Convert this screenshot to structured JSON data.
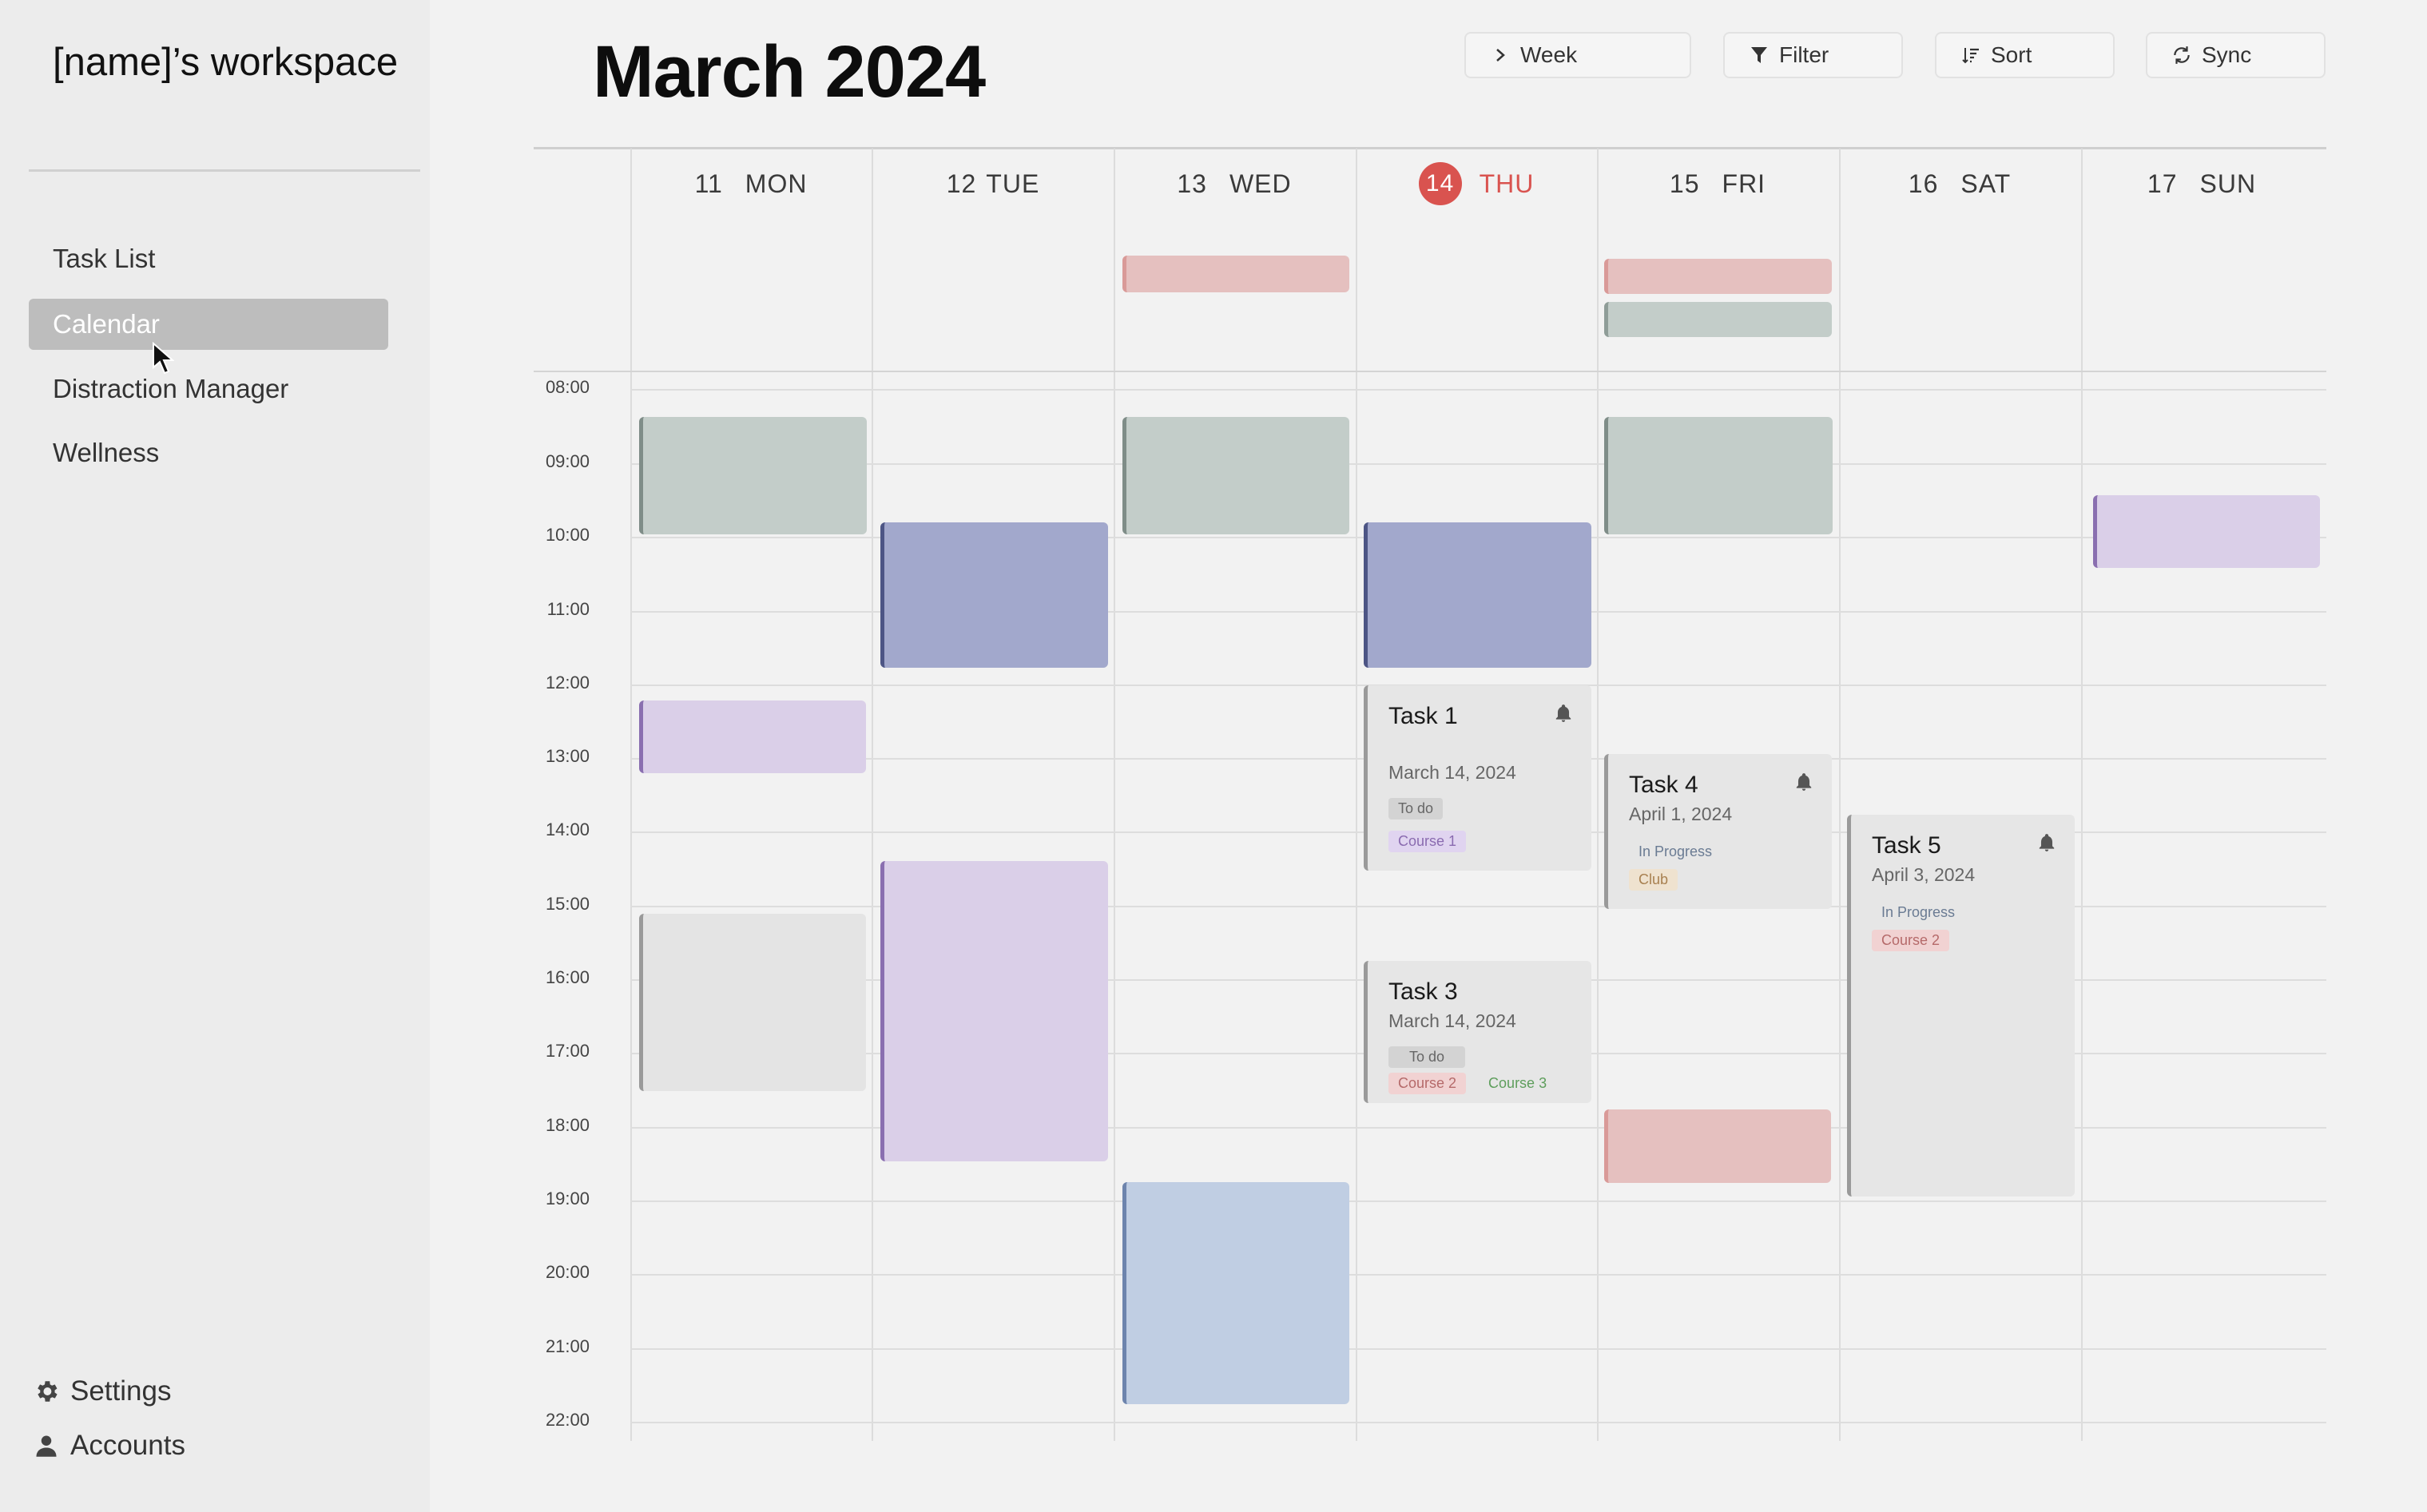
{
  "sidebar": {
    "workspace_title": "[name]’s workspace",
    "items": [
      {
        "label": "Task List"
      },
      {
        "label": "Calendar"
      },
      {
        "label": "Distraction Manager"
      },
      {
        "label": "Wellness"
      }
    ],
    "bottom": {
      "settings": "Settings",
      "accounts": "Accounts"
    }
  },
  "header": {
    "title": "March 2024",
    "buttons": {
      "week": "Week",
      "filter": "Filter",
      "sort": "Sort",
      "sync": "Sync"
    }
  },
  "calendar": {
    "days": [
      {
        "num": "11",
        "name": "MON"
      },
      {
        "num": "12",
        "name": "TUE"
      },
      {
        "num": "13",
        "name": "WED"
      },
      {
        "num": "14",
        "name": "THU",
        "today": true
      },
      {
        "num": "15",
        "name": "FRI"
      },
      {
        "num": "16",
        "name": "SAT"
      },
      {
        "num": "17",
        "name": "SUN"
      }
    ],
    "hours": [
      "08:00",
      "09:00",
      "10:00",
      "11:00",
      "12:00",
      "13:00",
      "14:00",
      "15:00",
      "16:00",
      "17:00",
      "18:00",
      "19:00",
      "20:00",
      "21:00",
      "22:00"
    ],
    "colors": {
      "sage": "#c3cdc9",
      "indigo": "#a2a8cc",
      "lavender": "#dacfe8",
      "rose": "#e5c0bf",
      "grey": "#e4e4e4",
      "blue": "#c0ceE3",
      "today_red": "#d9534f"
    },
    "tasks": {
      "task1": {
        "title": "Task 1",
        "date": "March 14, 2024",
        "status": "To do",
        "tags": [
          "Course 1"
        ]
      },
      "task3": {
        "title": "Task 3",
        "date": "March 14, 2024",
        "status": "To do",
        "tags": [
          "Course 2",
          "Course 3"
        ]
      },
      "task4": {
        "title": "Task 4",
        "date": "April 1, 2024",
        "status": "In Progress",
        "tags": [
          "Club"
        ]
      },
      "task5": {
        "title": "Task 5",
        "date": "April 3, 2024",
        "status": "In Progress",
        "tags": [
          "Course 2"
        ]
      }
    }
  }
}
